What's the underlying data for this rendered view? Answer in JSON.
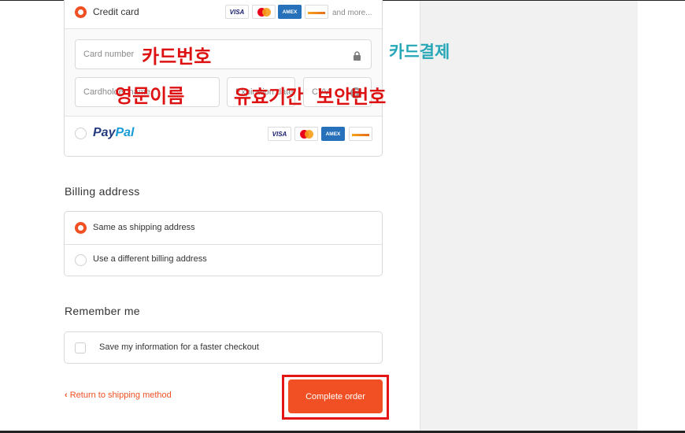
{
  "payment": {
    "credit_card_label": "Credit card",
    "more_cards": "and more...",
    "card_number_placeholder": "Card number",
    "cardholder_placeholder": "Cardholder name",
    "expiry_placeholder": "Expiration date (MM / YY)",
    "cvv_placeholder": "CVV",
    "paypal_label_left": "Pay",
    "paypal_label_right": "Pal",
    "card_brands": [
      "VISA",
      "mastercard",
      "AMEX",
      "discover"
    ]
  },
  "annotations": {
    "card_number": "카드번호",
    "card_payment": "카드결제",
    "english_name": "영문이름",
    "expiry": "유효기간",
    "security_code": "보안번호"
  },
  "billing": {
    "title": "Billing address",
    "same_as_shipping": "Same as shipping address",
    "different_billing": "Use a different billing address",
    "selected": "same_as_shipping"
  },
  "remember": {
    "title": "Remember me",
    "save_info": "Save my information for a faster checkout",
    "checked": false
  },
  "footer": {
    "return_link": "Return to shipping method",
    "complete_button": "Complete order"
  },
  "colors": {
    "accent": "#f05023",
    "highlight_box": "#e31515",
    "annotation_red": "#dd1111",
    "annotation_teal": "#26a7b8"
  }
}
